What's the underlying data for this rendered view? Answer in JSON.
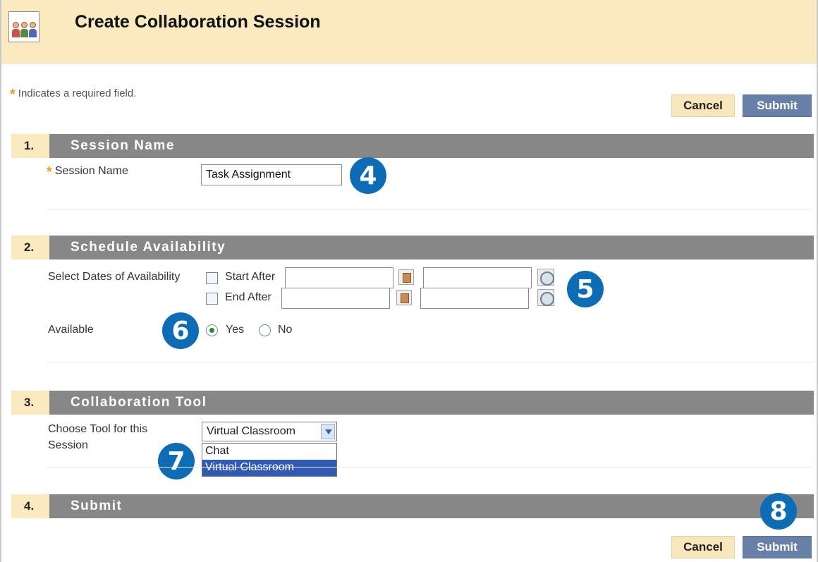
{
  "header": {
    "title": "Create Collaboration Session",
    "icon": "group-icon"
  },
  "required_note": "Indicates a required field.",
  "buttons": {
    "cancel": "Cancel",
    "submit": "Submit"
  },
  "sections": [
    {
      "number": "1.",
      "title": "Session Name"
    },
    {
      "number": "2.",
      "title": "Schedule Availability"
    },
    {
      "number": "3.",
      "title": "Collaboration Tool"
    },
    {
      "number": "4.",
      "title": "Submit"
    }
  ],
  "session_name": {
    "label": "Session Name",
    "value": "Task Assignment"
  },
  "schedule": {
    "label": "Select Dates of Availability",
    "start_label": "Start After",
    "end_label": "End After",
    "available_label": "Available",
    "yes": "Yes",
    "no": "No"
  },
  "tool": {
    "label_line1": "Choose Tool for this",
    "label_line2": "Session",
    "selected": "Virtual Classroom",
    "options": [
      "Chat",
      "Virtual Classroom"
    ]
  },
  "callouts": [
    "4",
    "5",
    "6",
    "7",
    "8"
  ],
  "colors": {
    "header": "#fbe9bf",
    "section_bar": "#878787",
    "submit": "#6780a7",
    "required_star": "#f29b1d",
    "callout": "#0d6cb6"
  }
}
